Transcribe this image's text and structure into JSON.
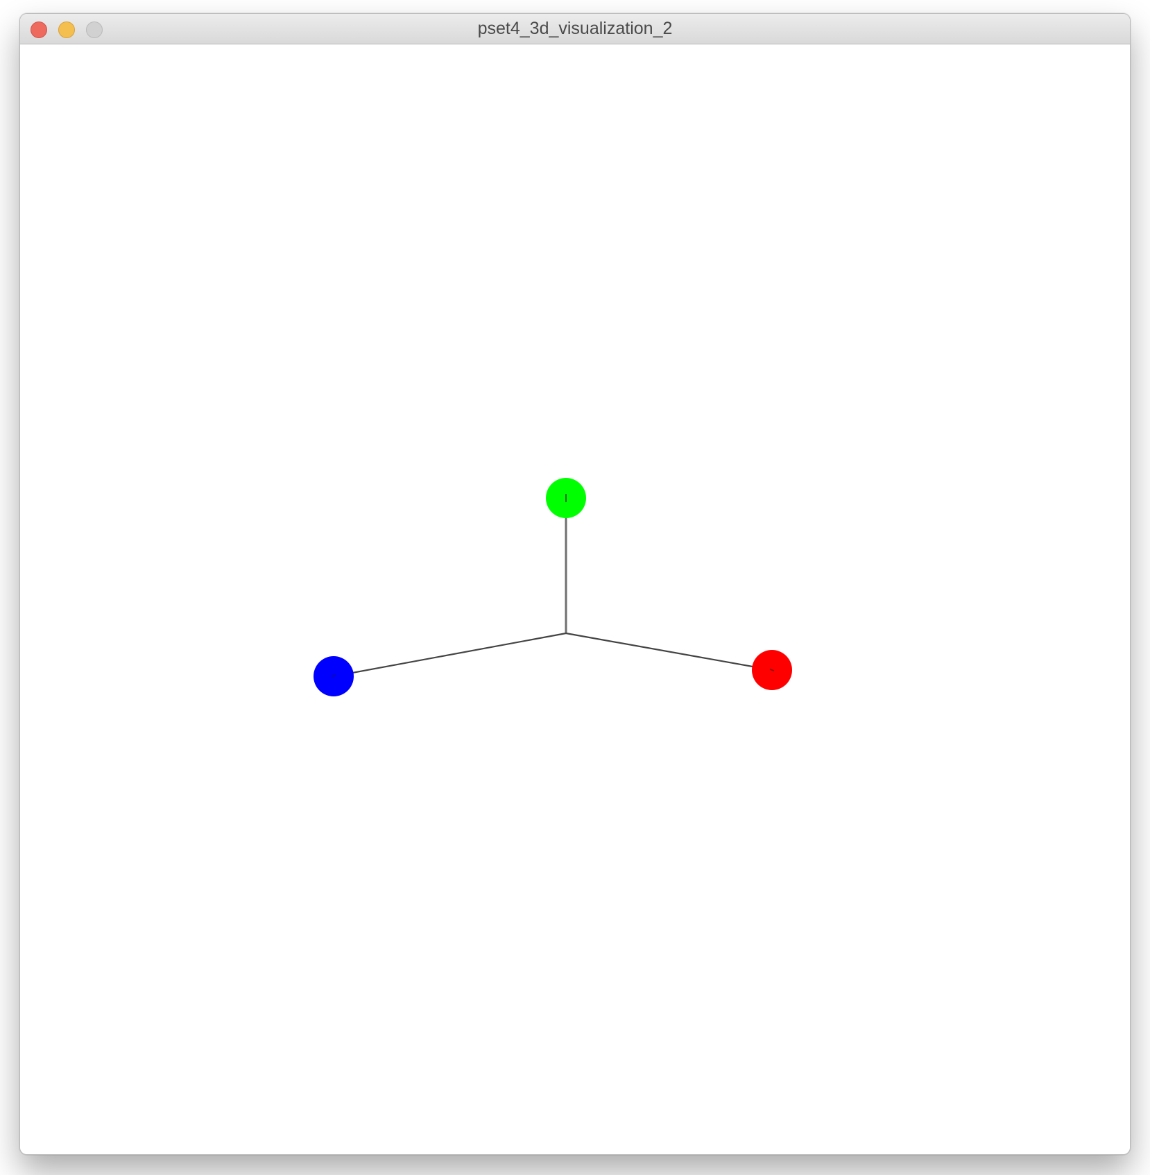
{
  "window": {
    "title": "pset4_3d_visualization_2"
  },
  "scene": {
    "background": "#ffffff",
    "axes": [
      {
        "name": "x",
        "color": "#ff0000",
        "marker_color": "#ff0000"
      },
      {
        "name": "y",
        "color": "#00ff00",
        "marker_color": "#00ff00"
      },
      {
        "name": "z",
        "color": "#0000ff",
        "marker_color": "#0000ff"
      }
    ],
    "line_color": "#555555"
  },
  "traffic_lights": {
    "close": "#ee6a5e",
    "minimize": "#f5bf4f",
    "zoom": "#d1d1d1"
  }
}
